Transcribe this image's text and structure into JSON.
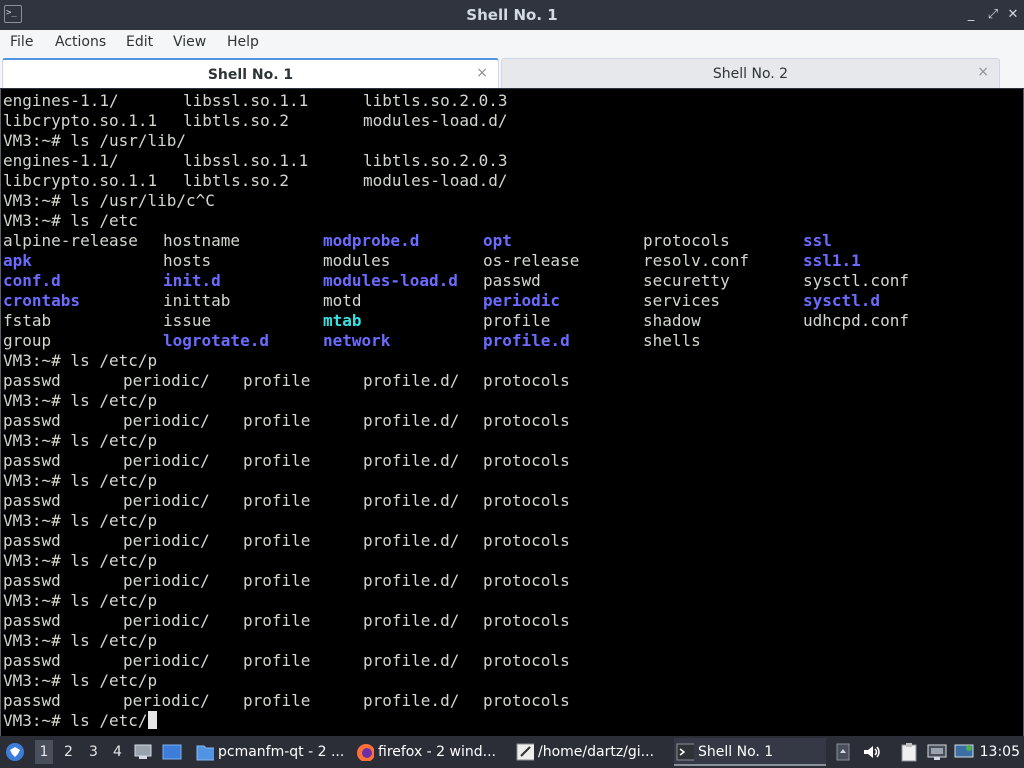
{
  "window": {
    "title": "Shell No. 1",
    "buttons": {
      "minimize": "_",
      "maximize": "⤢",
      "close": "✕"
    }
  },
  "menu": [
    "File",
    "Actions",
    "Edit",
    "View",
    "Help"
  ],
  "tabs": [
    {
      "label": "Shell No. 1",
      "active": true,
      "close": "×"
    },
    {
      "label": "Shell No. 2",
      "active": false,
      "close": "×"
    }
  ],
  "terminal": {
    "lines": [
      [
        [
          "engines-1.1/",
          0
        ],
        [
          "libssl.so.1.1",
          180
        ],
        [
          "libtls.so.2.0.3",
          360
        ]
      ],
      [
        [
          "libcrypto.so.1.1",
          0
        ],
        [
          "libtls.so.2",
          180
        ],
        [
          "modules-load.d/",
          360
        ]
      ],
      [
        [
          "VM3:~# ls /usr/lib/",
          0
        ]
      ],
      [
        [
          "engines-1.1/",
          0
        ],
        [
          "libssl.so.1.1",
          180
        ],
        [
          "libtls.so.2.0.3",
          360
        ]
      ],
      [
        [
          "libcrypto.so.1.1",
          0
        ],
        [
          "libtls.so.2",
          180
        ],
        [
          "modules-load.d/",
          360
        ]
      ],
      [
        [
          "VM3:~# ls /usr/lib/c^C",
          0
        ]
      ],
      [
        [
          "VM3:~# ls /etc",
          0
        ]
      ],
      [
        [
          "alpine-release",
          0
        ],
        [
          "hostname",
          160
        ],
        [
          "modprobe.d",
          320,
          "dir"
        ],
        [
          "opt",
          480,
          "dir"
        ],
        [
          "protocols",
          640
        ],
        [
          "ssl",
          800,
          "dir"
        ]
      ],
      [
        [
          "apk",
          0,
          "dir"
        ],
        [
          "hosts",
          160
        ],
        [
          "modules",
          320
        ],
        [
          "os-release",
          480
        ],
        [
          "resolv.conf",
          640
        ],
        [
          "ssl1.1",
          800,
          "dir"
        ]
      ],
      [
        [
          "conf.d",
          0,
          "dir"
        ],
        [
          "init.d",
          160,
          "dir"
        ],
        [
          "modules-load.d",
          320,
          "dir"
        ],
        [
          "passwd",
          480
        ],
        [
          "securetty",
          640
        ],
        [
          "sysctl.conf",
          800
        ]
      ],
      [
        [
          "crontabs",
          0,
          "dir"
        ],
        [
          "inittab",
          160
        ],
        [
          "motd",
          320
        ],
        [
          "periodic",
          480,
          "dir"
        ],
        [
          "services",
          640
        ],
        [
          "sysctl.d",
          800,
          "dir"
        ]
      ],
      [
        [
          "fstab",
          0
        ],
        [
          "issue",
          160
        ],
        [
          "mtab",
          320,
          "link"
        ],
        [
          "profile",
          480
        ],
        [
          "shadow",
          640
        ],
        [
          "udhcpd.conf",
          800
        ]
      ],
      [
        [
          "group",
          0
        ],
        [
          "logrotate.d",
          160,
          "dir"
        ],
        [
          "network",
          320,
          "dir"
        ],
        [
          "profile.d",
          480,
          "dir"
        ],
        [
          "shells",
          640
        ]
      ],
      [
        [
          "VM3:~# ls /etc/p",
          0
        ]
      ],
      [
        [
          "passwd",
          0
        ],
        [
          "periodic/",
          120
        ],
        [
          "profile",
          240
        ],
        [
          "profile.d/",
          360
        ],
        [
          "protocols",
          480
        ]
      ],
      [
        [
          "VM3:~# ls /etc/p",
          0
        ]
      ],
      [
        [
          "passwd",
          0
        ],
        [
          "periodic/",
          120
        ],
        [
          "profile",
          240
        ],
        [
          "profile.d/",
          360
        ],
        [
          "protocols",
          480
        ]
      ],
      [
        [
          "VM3:~# ls /etc/p",
          0
        ]
      ],
      [
        [
          "passwd",
          0
        ],
        [
          "periodic/",
          120
        ],
        [
          "profile",
          240
        ],
        [
          "profile.d/",
          360
        ],
        [
          "protocols",
          480
        ]
      ],
      [
        [
          "VM3:~# ls /etc/p",
          0
        ]
      ],
      [
        [
          "passwd",
          0
        ],
        [
          "periodic/",
          120
        ],
        [
          "profile",
          240
        ],
        [
          "profile.d/",
          360
        ],
        [
          "protocols",
          480
        ]
      ],
      [
        [
          "VM3:~# ls /etc/p",
          0
        ]
      ],
      [
        [
          "passwd",
          0
        ],
        [
          "periodic/",
          120
        ],
        [
          "profile",
          240
        ],
        [
          "profile.d/",
          360
        ],
        [
          "protocols",
          480
        ]
      ],
      [
        [
          "VM3:~# ls /etc/p",
          0
        ]
      ],
      [
        [
          "passwd",
          0
        ],
        [
          "periodic/",
          120
        ],
        [
          "profile",
          240
        ],
        [
          "profile.d/",
          360
        ],
        [
          "protocols",
          480
        ]
      ],
      [
        [
          "VM3:~# ls /etc/p",
          0
        ]
      ],
      [
        [
          "passwd",
          0
        ],
        [
          "periodic/",
          120
        ],
        [
          "profile",
          240
        ],
        [
          "profile.d/",
          360
        ],
        [
          "protocols",
          480
        ]
      ],
      [
        [
          "VM3:~# ls /etc/p",
          0
        ]
      ],
      [
        [
          "passwd",
          0
        ],
        [
          "periodic/",
          120
        ],
        [
          "profile",
          240
        ],
        [
          "profile.d/",
          360
        ],
        [
          "protocols",
          480
        ]
      ],
      [
        [
          "VM3:~# ls /etc/p",
          0
        ]
      ],
      [
        [
          "passwd",
          0
        ],
        [
          "periodic/",
          120
        ],
        [
          "profile",
          240
        ],
        [
          "profile.d/",
          360
        ],
        [
          "protocols",
          480
        ]
      ]
    ],
    "prompt_line": "VM3:~# ls /etc/",
    "colors": {
      "background": "#000000",
      "text": "#d3d7cf",
      "directory": "#6b6bff",
      "symlink": "#34e2e2"
    }
  },
  "taskbar": {
    "workspaces": [
      "1",
      "2",
      "3",
      "4"
    ],
    "tasks": [
      {
        "label": "pcmanfm-qt - 2 ...",
        "icon": "folder-icon"
      },
      {
        "label": "firefox - 2 wind...",
        "icon": "firefox-icon"
      },
      {
        "label": "/home/dartz/gi...",
        "icon": "text-editor-icon"
      },
      {
        "label": "Shell No. 1",
        "icon": "terminal-icon"
      }
    ],
    "clock": "13:05"
  }
}
